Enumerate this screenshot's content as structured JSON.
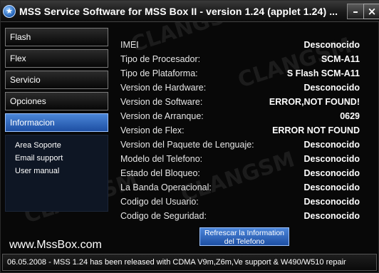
{
  "window": {
    "icon_glyph": "★",
    "title": "MSS Service Software for MSS Box II - version 1.24 (applet 1.24) ...",
    "minimize_glyph": "–",
    "close_glyph": "×"
  },
  "watermark_text": "CLANGSM",
  "sidebar": {
    "items": [
      {
        "label": "Flash"
      },
      {
        "label": "Flex"
      },
      {
        "label": "Servicio"
      },
      {
        "label": "Opciones"
      },
      {
        "label": "Informacion"
      }
    ],
    "submenu": [
      {
        "label": "Area Soporte"
      },
      {
        "label": "Email support"
      },
      {
        "label": "User manual"
      }
    ],
    "site": "www.MssBox.com"
  },
  "info": {
    "rows": [
      {
        "label": "IMEI",
        "value": "Desconocido"
      },
      {
        "label": "Tipo de Procesador:",
        "value": "SCM-A11"
      },
      {
        "label": "Tipo de Plataforma:",
        "value": "S Flash SCM-A11"
      },
      {
        "label": "Version de Hardware:",
        "value": "Desconocido"
      },
      {
        "label": "Version de Software:",
        "value": "ERROR,NOT FOUND!"
      },
      {
        "label": "Version de Arranque:",
        "value": "0629"
      },
      {
        "label": "Version de Flex:",
        "value": "ERROR NOT FOUND"
      },
      {
        "label": "Version del Paquete de Lenguaje:",
        "value": "Desconocido"
      },
      {
        "label": "Modelo del Telefono:",
        "value": "Desconocido"
      },
      {
        "label": "Estado del Bloqueo:",
        "value": "Desconocido"
      },
      {
        "label": "La Banda Operacional:",
        "value": "Desconocido"
      },
      {
        "label": "Codigo del Usuario:",
        "value": "Desconocido"
      },
      {
        "label": "Codigo de Seguridad:",
        "value": "Desconocido"
      }
    ],
    "refresh_line1": "Refrescar la Information",
    "refresh_line2": "del Telefono"
  },
  "status": {
    "text": "06.05.2008 - MSS 1.24 has been released with CDMA V9m,Z6m,Ve support & W490/W510 repair"
  }
}
